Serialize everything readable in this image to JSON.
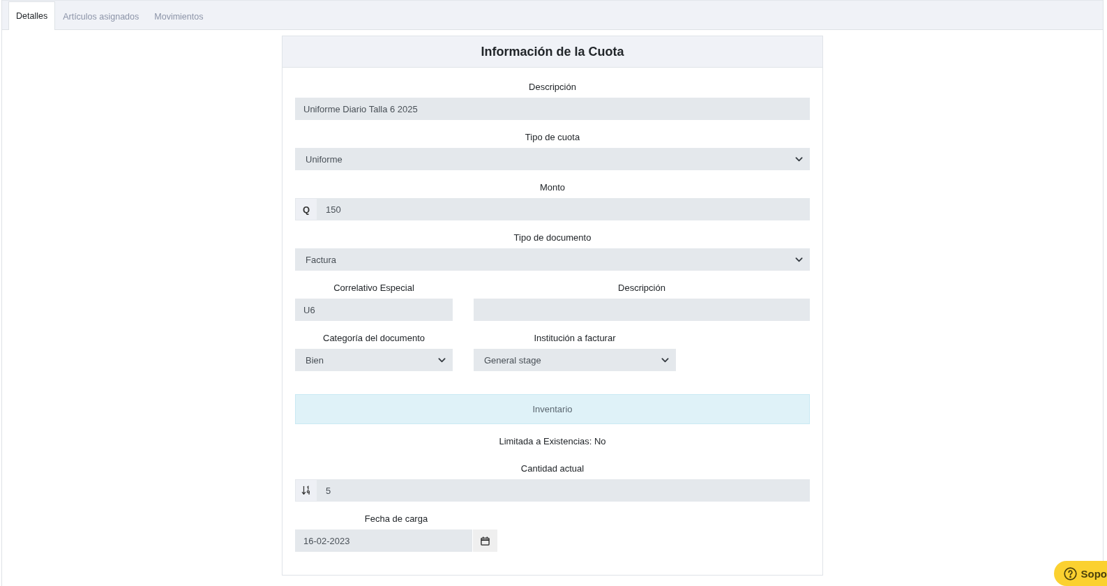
{
  "tabs": [
    {
      "label": "Detalles",
      "selected": true
    },
    {
      "label": "Artículos asignados",
      "selected": false
    },
    {
      "label": "Movimientos",
      "selected": false
    }
  ],
  "card": {
    "title": "Información de la Cuota",
    "items": [
      {
        "kind": "text",
        "label": "Descripción",
        "value": "Uniforme Diario Talla 6 2025"
      },
      {
        "kind": "select",
        "label": "Tipo de cuota",
        "value": "Uniforme"
      },
      {
        "kind": "currency",
        "label": "Monto",
        "prefix": "Q",
        "value": "150"
      },
      {
        "kind": "select",
        "label": "Tipo de documento",
        "value": "Factura"
      },
      {
        "kind": "pair",
        "fields": [
          {
            "kind": "text",
            "label": "Correlativo Especial",
            "value": "U6"
          },
          {
            "kind": "text",
            "label": "Descripción"
          }
        ]
      },
      {
        "kind": "pair",
        "fields": [
          {
            "kind": "select",
            "label": "Categoría del documento",
            "value": "Bien"
          },
          {
            "kind": "select",
            "label": "Institución a facturar",
            "value": "General stage"
          }
        ]
      },
      {
        "kind": "banner",
        "text": "Inventario"
      },
      {
        "kind": "note",
        "text": "Limitada a Existencias: No"
      },
      {
        "kind": "number",
        "label": "Cantidad actual",
        "value": "5"
      },
      {
        "kind": "date",
        "label": "Fecha de carga",
        "value": "16-02-2023"
      }
    ]
  },
  "support_button": {
    "label": "Sopo"
  }
}
